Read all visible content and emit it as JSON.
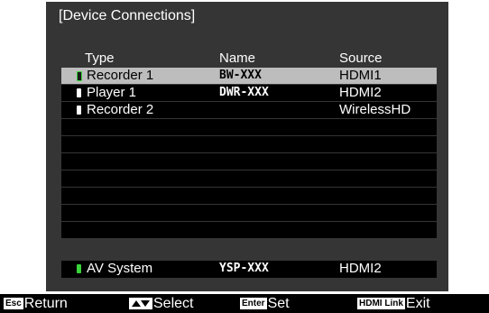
{
  "title": "[Device Connections]",
  "columns": {
    "type": "Type",
    "name": "Name",
    "source": "Source"
  },
  "rows": [
    {
      "type": "Recorder 1",
      "name": "BW-XXX",
      "source": "HDMI1",
      "indicator": "green-outline"
    },
    {
      "type": "Player 1",
      "name": "DWR-XXX",
      "source": "HDMI2",
      "indicator": "white"
    },
    {
      "type": "Recorder 2",
      "name": "",
      "source": "WirelessHD",
      "indicator": "white"
    }
  ],
  "system": {
    "type": "AV System",
    "name": "YSP-XXX",
    "source": "HDMI2",
    "indicator": "green"
  },
  "footer": {
    "esc_key": "Esc",
    "esc_label": "Return",
    "select_key_icon": "up-down-triangle-icon",
    "select_label": "Select",
    "enter_key": "Enter",
    "enter_label": "Set",
    "hdmi_key": "HDMI Link",
    "hdmi_label": "Exit"
  },
  "colors": {
    "panel": "#353535",
    "row": "#000000",
    "selected": "#bdbdbd",
    "indicator_green": "#39d33a"
  }
}
